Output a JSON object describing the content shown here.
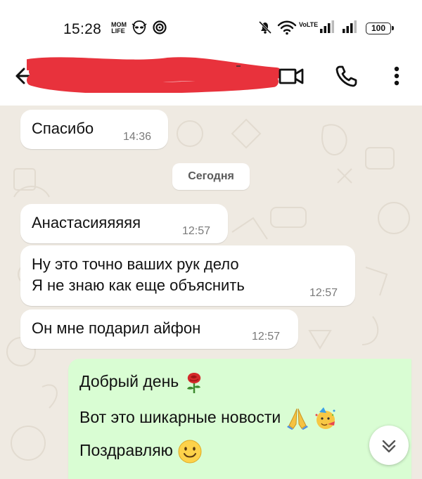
{
  "status_bar": {
    "time": "15:28",
    "mini_icon_1": "MOM LIFE",
    "mini_icon_3": "VoLTE",
    "battery": "100"
  },
  "header": {
    "contact_name": "",
    "icons": [
      "back-arrow-icon",
      "video-call-icon",
      "phone-icon",
      "more-vert-icon"
    ]
  },
  "chat": {
    "messages": [
      {
        "text": "Спасибо",
        "time": "14:36"
      },
      {
        "text": "Анастасияяяяя",
        "time": "12:57"
      },
      {
        "lines": [
          "Ну это точно ваших рук дело",
          "Я не знаю как еще объяснить"
        ],
        "time": "12:57"
      },
      {
        "text": "Он мне подарил айфон",
        "time": "12:57"
      }
    ],
    "date_separator": "Сегодня",
    "outgoing": {
      "lines": [
        "Добрый день",
        "Вот это шикарные новости",
        "Поздравляю"
      ],
      "emojis": [
        "rose-emoji",
        "folded-hands-emoji",
        "party-face-emoji",
        "smiling-face-emoji"
      ]
    }
  },
  "colors": {
    "chat_background": "#efeae2",
    "incoming_bubble": "#ffffff",
    "outgoing_bubble": "#d9fdd3",
    "redaction": "#e8323c"
  }
}
